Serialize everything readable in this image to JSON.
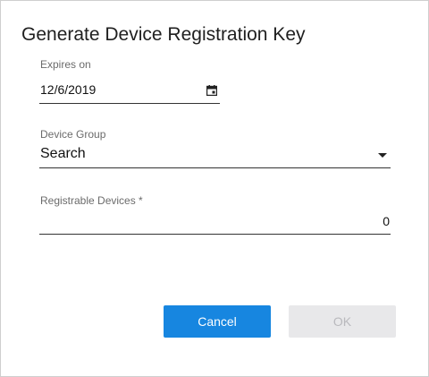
{
  "dialog": {
    "title": "Generate Device Registration Key"
  },
  "expires": {
    "label": "Expires on",
    "value": "12/6/2019",
    "icon": "calendar-icon"
  },
  "device_group": {
    "label": "Device Group",
    "value": "Search",
    "icon": "caret-down-icon"
  },
  "registrable": {
    "label": "Registrable Devices *",
    "value": "0"
  },
  "buttons": {
    "cancel": "Cancel",
    "ok": "OK"
  },
  "colors": {
    "primary": "#1786e0",
    "disabled_bg": "#e8e8ea",
    "disabled_text": "#b9b9bd"
  }
}
